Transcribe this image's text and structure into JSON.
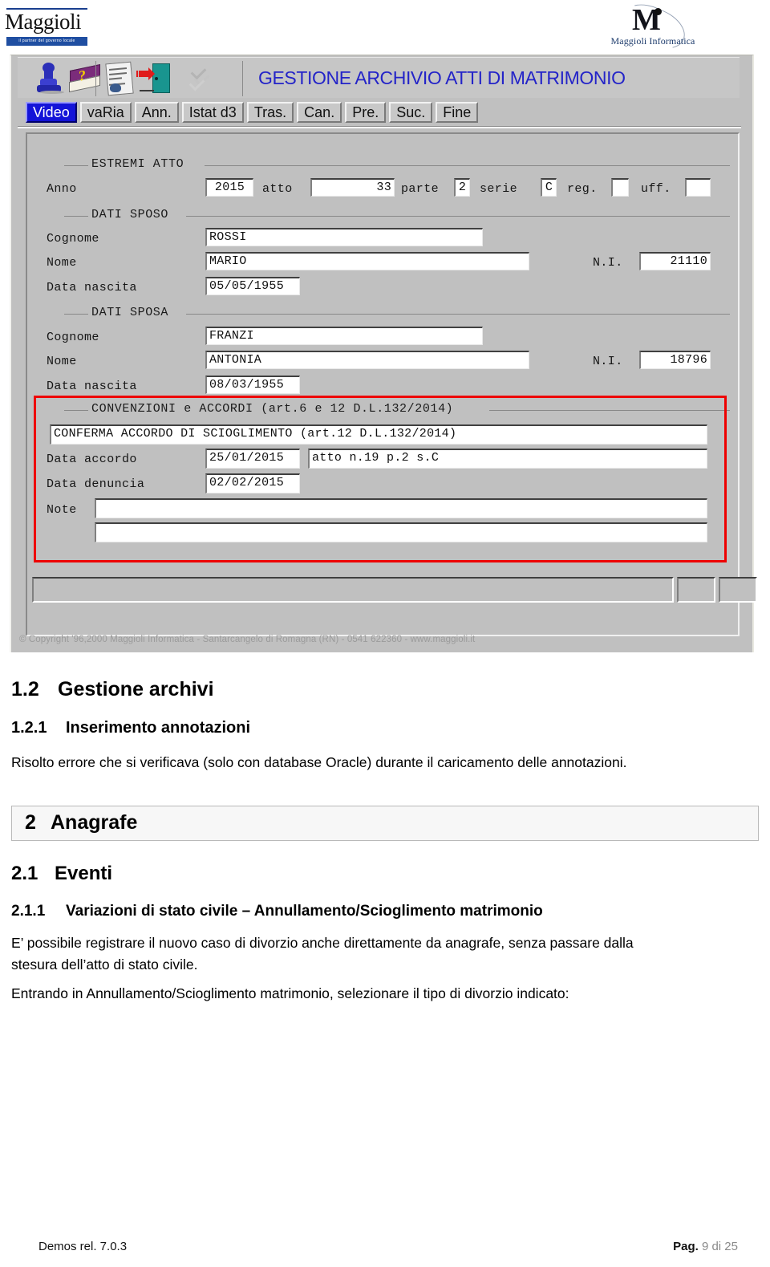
{
  "page_header": {
    "brand_logo": {
      "wordmark": "Maggioli",
      "tagline": "il partner del governo locale"
    },
    "informatica_logo": {
      "monogram": "M",
      "name": "Maggioli Informatica"
    }
  },
  "app": {
    "title": "GESTIONE ARCHIVIO ATTI DI MATRIMONIO",
    "toolbar_icons": [
      {
        "name": "pawn-icon",
        "label": "pawn"
      },
      {
        "name": "help-book-icon",
        "label": "help book"
      },
      {
        "name": "document-list-icon",
        "label": "document list"
      },
      {
        "name": "exit-door-icon",
        "label": "exit"
      },
      {
        "name": "checkmarks-icon",
        "label": "checks"
      }
    ],
    "menu_buttons": [
      {
        "label": "Video",
        "selected": true
      },
      {
        "label": "vaRia",
        "selected": false
      },
      {
        "label": "Ann.",
        "selected": false
      },
      {
        "label": "Istat d3",
        "selected": false
      },
      {
        "label": "Tras.",
        "selected": false
      },
      {
        "label": "Can.",
        "selected": false
      },
      {
        "label": "Pre.",
        "selected": false
      },
      {
        "label": "Suc.",
        "selected": false
      },
      {
        "label": "Fine",
        "selected": false
      }
    ],
    "groups": {
      "estremi_atto": {
        "legend": "ESTREMI ATTO",
        "fields": {
          "anno_label": "Anno",
          "anno_value": "2015",
          "atto_label": "atto",
          "atto_value": "33",
          "parte_label": "parte",
          "parte_value": "2",
          "serie_label": "serie",
          "serie_value": "C",
          "reg_label": "reg.",
          "reg_value": "",
          "uff_label": "uff.",
          "uff_value": ""
        }
      },
      "dati_sposo": {
        "legend": "DATI SPOSO",
        "fields": {
          "cognome_label": "Cognome",
          "cognome_value": "ROSSI",
          "nome_label": "Nome",
          "nome_value": "MARIO",
          "ni_label": "N.I.",
          "ni_value": "21110",
          "data_nascita_label": "Data nascita",
          "data_nascita_value": "05/05/1955"
        }
      },
      "dati_sposa": {
        "legend": "DATI SPOSA",
        "fields": {
          "cognome_label": "Cognome",
          "cognome_value": "FRANZI",
          "nome_label": "Nome",
          "nome_value": "ANTONIA",
          "ni_label": "N.I.",
          "ni_value": "18796",
          "data_nascita_label": "Data nascita",
          "data_nascita_value": "08/03/1955"
        }
      },
      "convenzioni": {
        "legend": "CONVENZIONI e ACCORDI (art.6 e 12 D.L.132/2014)",
        "highlight_color": "#ee0000",
        "fields": {
          "tipo_value": "CONFERMA ACCORDO DI SCIOGLIMENTO (art.12 D.L.132/2014)",
          "data_accordo_label": "Data accordo",
          "data_accordo_value": "25/01/2015",
          "atto_rif_value": "atto n.19 p.2 s.C",
          "data_denuncia_label": "Data denuncia",
          "data_denuncia_value": "02/02/2015",
          "note_label": "Note",
          "note_line1": "",
          "note_line2": ""
        }
      }
    },
    "status_panels": [
      "",
      "",
      ""
    ],
    "copyright": "© Copyright '96,2000 Maggioli Informatica - Santarcangelo di Romagna (RN) - 0541 622360 - www.maggioli.it"
  },
  "document": {
    "section_1_2": {
      "number": "1.2",
      "title": "Gestione archivi"
    },
    "section_1_2_1": {
      "number": "1.2.1",
      "title": "Inserimento annotazioni",
      "body": "Risolto errore che si verificava (solo con database Oracle) durante il caricamento delle annotazioni."
    },
    "chapter_2": {
      "number": "2",
      "title": "Anagrafe"
    },
    "section_2_1": {
      "number": "2.1",
      "title": "Eventi"
    },
    "section_2_1_1": {
      "number": "2.1.1",
      "title": "Variazioni di stato civile – Annullamento/Scioglimento matrimonio",
      "body_line1": "E’ possibile registrare il nuovo caso di divorzio anche direttamente da anagrafe, senza passare dalla",
      "body_line2": "stesura dell’atto di stato civile.",
      "body_line3": "Entrando in Annullamento/Scioglimento matrimonio, selezionare il tipo di divorzio indicato:"
    }
  },
  "footer": {
    "left": "Demos rel. 7.0.3",
    "right_label": "Pag.",
    "right_value": "9 di 25"
  }
}
